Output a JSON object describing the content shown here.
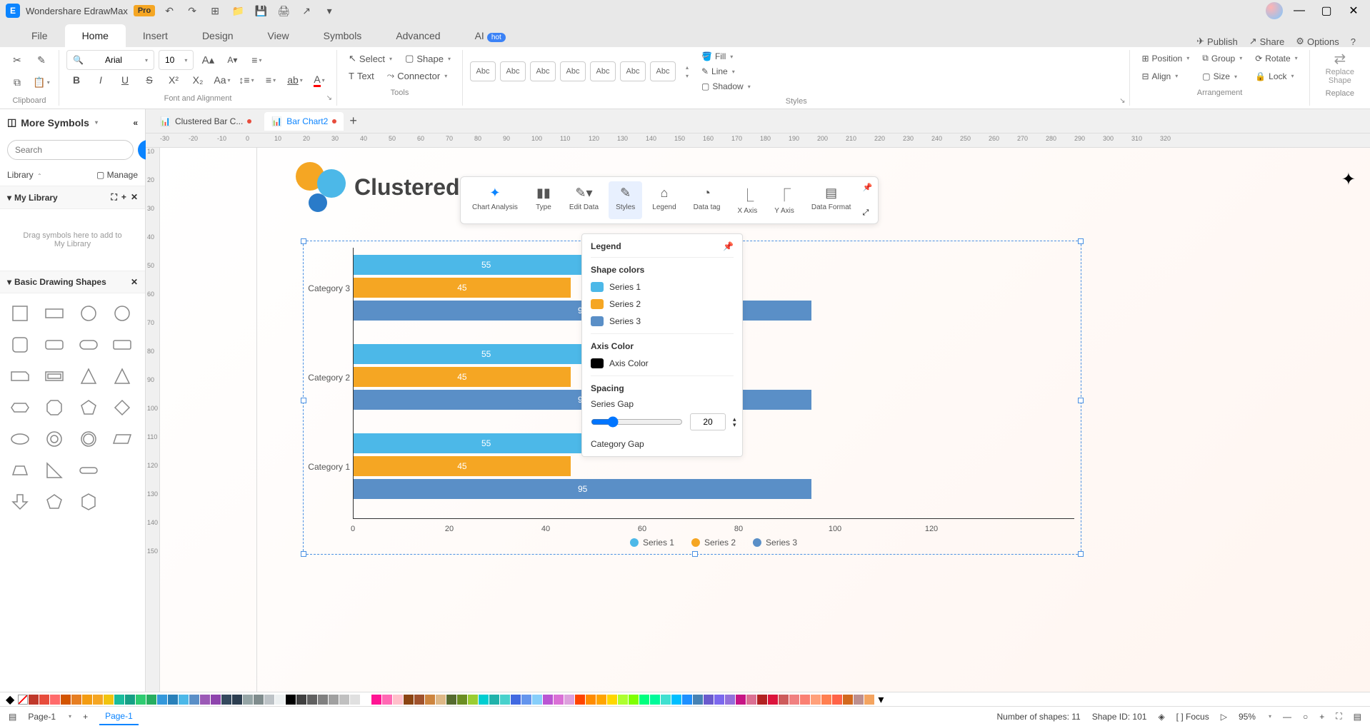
{
  "app": {
    "title": "Wondershare EdrawMax",
    "badge": "Pro"
  },
  "menu": {
    "tabs": [
      "File",
      "Home",
      "Insert",
      "Design",
      "View",
      "Symbols",
      "Advanced",
      "AI"
    ],
    "active": "Home",
    "hot": "hot",
    "right": {
      "publish": "Publish",
      "share": "Share",
      "options": "Options"
    }
  },
  "ribbon": {
    "font": "Arial",
    "size": "10",
    "select": "Select",
    "shape": "Shape",
    "text": "Text",
    "connector": "Connector",
    "clipboard": "Clipboard",
    "font_align": "Font and Alignment",
    "tools": "Tools",
    "styles": "Styles",
    "arrangement": "Arrangement",
    "replace": "Replace",
    "replace_shape_l1": "Replace",
    "replace_shape_l2": "Shape",
    "fill": "Fill",
    "line": "Line",
    "shadow": "Shadow",
    "position": "Position",
    "align": "Align",
    "group": "Group",
    "sizebtn": "Size",
    "rotate": "Rotate",
    "lock": "Lock",
    "abc": "Abc"
  },
  "sidebar": {
    "more_symbols": "More Symbols",
    "search_btn": "Search",
    "search_placeholder": "Search",
    "library": "Library",
    "manage": "Manage",
    "mylibrary": "My Library",
    "mylibrary_drop": "Drag symbols here to add to My Library",
    "basic_shapes": "Basic Drawing Shapes"
  },
  "docs": {
    "tab1": "Clustered Bar C...",
    "tab2": "Bar Chart2"
  },
  "chart_title": "Clustered",
  "chart_toolbar": {
    "chart_analysis": "Chart Analysis",
    "type": "Type",
    "edit_data": "Edit Data",
    "styles": "Styles",
    "legend": "Legend",
    "data_tag": "Data tag",
    "x_axis": "X Axis",
    "y_axis": "Y Axis",
    "data_format": "Data Format"
  },
  "legend_panel": {
    "title": "Legend",
    "shape_colors": "Shape colors",
    "series1": "Series 1",
    "series2": "Series 2",
    "series3": "Series 3",
    "axis_color_title": "Axis Color",
    "axis_color": "Axis Color",
    "spacing": "Spacing",
    "series_gap": "Series Gap",
    "series_gap_val": "20",
    "category_gap": "Category Gap"
  },
  "chart_data": {
    "type": "bar",
    "orientation": "horizontal",
    "title": "Clustered Bar Chart",
    "categories": [
      "Category 1",
      "Category 2",
      "Category 3"
    ],
    "series": [
      {
        "name": "Series 1",
        "color": "#4cb8e8",
        "values": [
          55,
          55,
          55
        ]
      },
      {
        "name": "Series 2",
        "color": "#f5a623",
        "values": [
          45,
          45,
          45
        ]
      },
      {
        "name": "Series 3",
        "color": "#5a8fc7",
        "values": [
          95,
          95,
          95
        ]
      }
    ],
    "x_ticks": [
      0,
      20,
      40,
      60,
      80,
      100,
      120
    ],
    "xlim": [
      0,
      120
    ],
    "xlabel": "",
    "ylabel": ""
  },
  "colors": {
    "series1": "#4cb8e8",
    "series2": "#f5a623",
    "series3": "#5a8fc7",
    "axis": "#000000"
  },
  "status": {
    "page": "Page-1",
    "page_tab": "Page-1",
    "shapes": "Number of shapes: 11",
    "shape_id": "Shape ID: 101",
    "focus": "Focus",
    "zoom": "95%"
  },
  "ruler_h": [
    "-30",
    "-20",
    "-10",
    "0",
    "10",
    "20",
    "30",
    "40",
    "50",
    "60",
    "70",
    "80",
    "90",
    "100",
    "110",
    "120",
    "130",
    "140",
    "150",
    "160",
    "170",
    "180",
    "190",
    "200",
    "210",
    "220",
    "230",
    "240",
    "250",
    "260",
    "270",
    "280",
    "290",
    "300",
    "310",
    "320"
  ],
  "ruler_v": [
    "10",
    "20",
    "30",
    "40",
    "50",
    "60",
    "70",
    "80",
    "90",
    "100",
    "110",
    "120",
    "130",
    "140",
    "150"
  ]
}
